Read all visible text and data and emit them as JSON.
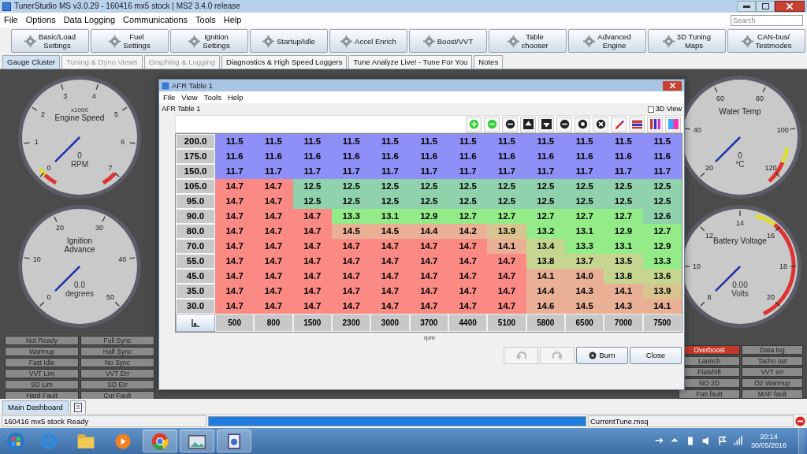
{
  "window": {
    "title": "TunerStudio MS v3.0.29 - 160416 mx5 stock | MS2 3.4.0 release"
  },
  "menu": [
    "File",
    "Options",
    "Data Logging",
    "Communications",
    "Tools",
    "Help"
  ],
  "search": {
    "placeholder": "Search"
  },
  "toolbar": [
    {
      "line1": "Basic/Load",
      "line2": "Settings"
    },
    {
      "line1": "Fuel",
      "line2": "Settings"
    },
    {
      "line1": "Ignition",
      "line2": "Settings"
    },
    {
      "line1": "Startup/Idle"
    },
    {
      "line1": "Accel Enrich"
    },
    {
      "line1": "Boost/VVT"
    },
    {
      "line1": "Table",
      "line2": "chooser"
    },
    {
      "line1": "Advanced",
      "line2": "Engine"
    },
    {
      "line1": "3D Tuning",
      "line2": "Maps"
    },
    {
      "line1": "CAN-bus/",
      "line2": "Testmodes"
    }
  ],
  "tabs": [
    {
      "label": "Gauge Cluster",
      "selected": true,
      "disabled": false
    },
    {
      "label": "Tuning & Dyno Views",
      "selected": false,
      "disabled": true
    },
    {
      "label": "Graphing & Logging",
      "selected": false,
      "disabled": true
    },
    {
      "label": "Diagnostics & High Speed Loggers",
      "selected": false,
      "disabled": false
    },
    {
      "label": "Tune Analyze Live! - Tune For You",
      "selected": false,
      "disabled": false
    },
    {
      "label": "Notes",
      "selected": false,
      "disabled": false
    }
  ],
  "gauges_left": [
    {
      "scale": "x1000",
      "title": "Engine Speed",
      "value": "0",
      "units": "RPM",
      "ticks": [
        "0",
        "1",
        "2",
        "3",
        "4",
        "5",
        "6",
        "7"
      ]
    },
    {
      "title": "Ignition Advance",
      "value": "0.0",
      "units": "degrees",
      "ticks": [
        "0",
        "10",
        "20",
        "30",
        "40",
        "50"
      ]
    }
  ],
  "gauges_right": [
    {
      "title": "Water Temp",
      "value": "0",
      "units": "°C",
      "ticks": [
        "20",
        "40",
        "60",
        "80",
        "100",
        "120"
      ]
    },
    {
      "title": "Battery Voltage",
      "value": "0.00",
      "units": "Volts",
      "ticks": [
        "8",
        "10",
        "12",
        "14",
        "16",
        "18",
        "20"
      ]
    }
  ],
  "indicators_left": [
    {
      "label": "Not Ready",
      "on": false
    },
    {
      "label": "Full Sync",
      "on": false
    },
    {
      "label": "Warmup",
      "on": false
    },
    {
      "label": "Half Sync",
      "on": false
    },
    {
      "label": "Fast Idle",
      "on": false
    },
    {
      "label": "No Sync",
      "on": false
    },
    {
      "label": "VVT Lim",
      "on": false
    },
    {
      "label": "VVT Err",
      "on": false
    },
    {
      "label": "SD Lim",
      "on": false
    },
    {
      "label": "SD Err",
      "on": false
    },
    {
      "label": "Hard Fault",
      "on": false
    },
    {
      "label": "Cur Fault",
      "on": false
    }
  ],
  "indicators_right": [
    {
      "label": "Overboost",
      "on": true
    },
    {
      "label": "Data log",
      "on": false
    },
    {
      "label": "Launch",
      "on": false
    },
    {
      "label": "Tacho out",
      "on": false
    },
    {
      "label": "Flatshift",
      "on": false
    },
    {
      "label": "VVT err",
      "on": false
    },
    {
      "label": "NO 2D",
      "on": false
    },
    {
      "label": "O2 Warmup",
      "on": false
    },
    {
      "label": "Fan fault",
      "on": false
    },
    {
      "label": "MAF fault",
      "on": false
    }
  ],
  "dialog": {
    "title": "AFR Table 1",
    "menu": [
      "File",
      "View",
      "Tools",
      "Help"
    ],
    "table_name": "AFR Table 1",
    "view_3d": {
      "label": "3D View",
      "checked": false
    },
    "columns": [
      "500",
      "800",
      "1500",
      "2300",
      "3000",
      "3700",
      "4400",
      "5100",
      "5800",
      "6500",
      "7000",
      "7500"
    ],
    "x_label": "rpm",
    "rows": [
      {
        "label": "200.0",
        "values": [
          "11.5",
          "11.5",
          "11.5",
          "11.5",
          "11.5",
          "11.5",
          "11.5",
          "11.5",
          "11.5",
          "11.5",
          "11.5",
          "11.5"
        ]
      },
      {
        "label": "175.0",
        "values": [
          "11.6",
          "11.6",
          "11.6",
          "11.6",
          "11.6",
          "11.6",
          "11.6",
          "11.6",
          "11.6",
          "11.6",
          "11.6",
          "11.6"
        ]
      },
      {
        "label": "150.0",
        "values": [
          "11.7",
          "11.7",
          "11.7",
          "11.7",
          "11.7",
          "11.7",
          "11.7",
          "11.7",
          "11.7",
          "11.7",
          "11.7",
          "11.7"
        ]
      },
      {
        "label": "105.0",
        "values": [
          "14.7",
          "14.7",
          "12.5",
          "12.5",
          "12.5",
          "12.5",
          "12.5",
          "12.5",
          "12.5",
          "12.5",
          "12.5",
          "12.5"
        ]
      },
      {
        "label": "95.0",
        "values": [
          "14.7",
          "14.7",
          "12.5",
          "12.5",
          "12.5",
          "12.5",
          "12.5",
          "12.5",
          "12.5",
          "12.5",
          "12.5",
          "12.5"
        ]
      },
      {
        "label": "90.0",
        "values": [
          "14.7",
          "14.7",
          "14.7",
          "13.3",
          "13.1",
          "12.9",
          "12.7",
          "12.7",
          "12.7",
          "12.7",
          "12.7",
          "12.6"
        ]
      },
      {
        "label": "80.0",
        "values": [
          "14.7",
          "14.7",
          "14.7",
          "14.5",
          "14.5",
          "14.4",
          "14.2",
          "13.9",
          "13.2",
          "13.1",
          "12.9",
          "12.7"
        ]
      },
      {
        "label": "70.0",
        "values": [
          "14.7",
          "14.7",
          "14.7",
          "14.7",
          "14.7",
          "14.7",
          "14.7",
          "14.1",
          "13.4",
          "13.3",
          "13.1",
          "12.9"
        ]
      },
      {
        "label": "55.0",
        "values": [
          "14.7",
          "14.7",
          "14.7",
          "14.7",
          "14.7",
          "14.7",
          "14.7",
          "14.7",
          "13.8",
          "13.7",
          "13.5",
          "13.3"
        ]
      },
      {
        "label": "45.0",
        "values": [
          "14.7",
          "14.7",
          "14.7",
          "14.7",
          "14.7",
          "14.7",
          "14.7",
          "14.7",
          "14.1",
          "14.0",
          "13.8",
          "13.6"
        ]
      },
      {
        "label": "35.0",
        "values": [
          "14.7",
          "14.7",
          "14.7",
          "14.7",
          "14.7",
          "14.7",
          "14.7",
          "14.7",
          "14.4",
          "14.3",
          "14.1",
          "13.9"
        ]
      },
      {
        "label": "30.0",
        "values": [
          "14.7",
          "14.7",
          "14.7",
          "14.7",
          "14.7",
          "14.7",
          "14.7",
          "14.7",
          "14.6",
          "14.5",
          "14.3",
          "14.1"
        ]
      }
    ],
    "buttons": [
      {
        "label": "Burn",
        "kind": "burn"
      },
      {
        "label": "Close",
        "kind": "plain"
      }
    ]
  },
  "bottom_tabs": [
    {
      "label": "Main Dashboard",
      "selected": true
    }
  ],
  "status_bar": {
    "project": "160416 mx5 stock Ready",
    "progress": {
      "level": 1
    },
    "file": "CurrentTune.msq"
  },
  "clock": {
    "time": "20:14",
    "date": "30/05/2016"
  }
}
